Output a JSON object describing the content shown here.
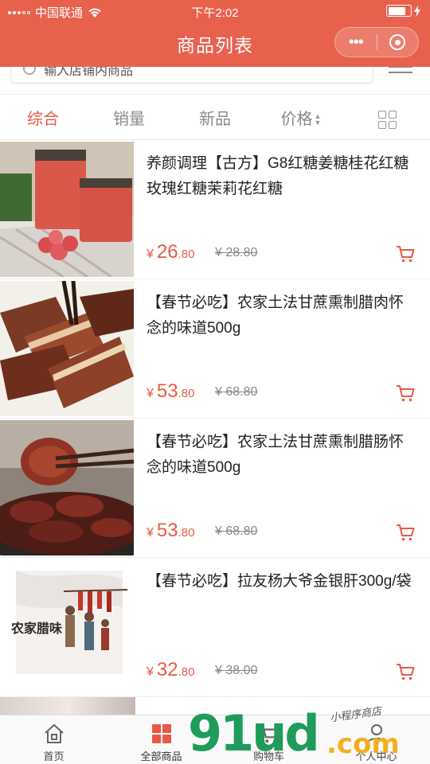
{
  "status_bar": {
    "carrier": "中国联通",
    "time": "下午2:02"
  },
  "nav": {
    "title": "商品列表",
    "more_label": "•••"
  },
  "search": {
    "placeholder": "输入店铺内商品"
  },
  "sort_tabs": [
    {
      "label": "综合",
      "active": true
    },
    {
      "label": "销量",
      "active": false
    },
    {
      "label": "新品",
      "active": false
    },
    {
      "label": "价格",
      "active": false
    }
  ],
  "products": [
    {
      "name": "养颜调理【古方】G8红糖姜糖桂花红糖玫瑰红糖茉莉花红糖",
      "price_int": "26",
      "price_dec": ".80",
      "currency": "¥",
      "original_price": "¥ 28.80",
      "thumb": "red-sugar-jars"
    },
    {
      "name": "【春节必吃】农家土法甘蔗熏制腊肉怀念的味道500g",
      "price_int": "53",
      "price_dec": ".80",
      "currency": "¥",
      "original_price": "¥ 68.80",
      "thumb": "smoked-pork"
    },
    {
      "name": "【春节必吃】农家土法甘蔗熏制腊肠怀念的味道500g",
      "price_int": "53",
      "price_dec": ".80",
      "currency": "¥",
      "original_price": "¥ 68.80",
      "thumb": "smoked-sausage"
    },
    {
      "name": "【春节必吃】拉友杨大爷金银肝300g/袋",
      "price_int": "32",
      "price_dec": ".80",
      "currency": "¥",
      "original_price": "¥ 38.00",
      "thumb": "farm-cured-meat-poster"
    }
  ],
  "poster_text": "农家腊味",
  "tabbar": [
    {
      "label": "首页",
      "icon": "home-icon"
    },
    {
      "label": "全部商品",
      "icon": "all-products-icon"
    },
    {
      "label": "购物车",
      "icon": "cart-icon"
    },
    {
      "label": "个人中心",
      "icon": "profile-icon"
    }
  ],
  "watermark": {
    "main": "91ud",
    "suffix": ".com",
    "small": "小程序商店"
  },
  "colors": {
    "brand": "#e8614d",
    "price": "#e65a44",
    "watermark_green": "#1f9b5a",
    "watermark_yellow": "#f0b020"
  }
}
